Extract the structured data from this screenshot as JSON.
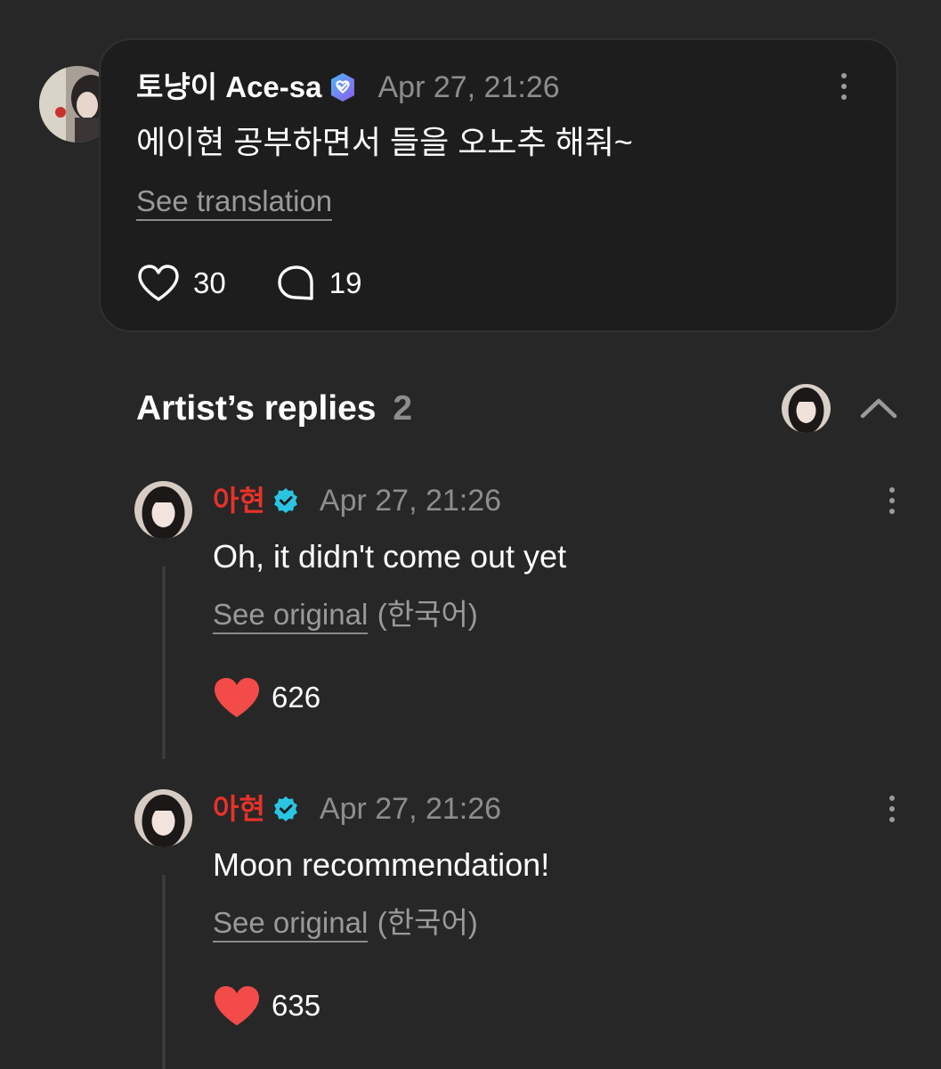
{
  "post": {
    "author": "토냥이 Ace-sa",
    "timestamp": "Apr 27, 21:26",
    "text": "에이현 공부하면서 들을 오노추 해줘~",
    "translation_link": "See translation",
    "likes": "30",
    "comments": "19",
    "badge_color": "#7b6cf0"
  },
  "replies_section": {
    "title": "Artist’s replies",
    "count": "2"
  },
  "replies": [
    {
      "author": "아현",
      "timestamp": "Apr 27, 21:26",
      "text": "Oh, it didn't come out yet",
      "original_link": "See original",
      "original_lang": "(한국어)",
      "likes": "626"
    },
    {
      "author": "아현",
      "timestamp": "Apr 27, 21:26",
      "text": "Moon recommendation!",
      "original_link": "See original",
      "original_lang": "(한국어)",
      "likes": "635"
    }
  ],
  "colors": {
    "background": "#272727",
    "card": "#1d1d1d",
    "artist_name": "#e8322a",
    "heart_filled": "#f24b48",
    "verified_artist": "#29c5e3"
  },
  "icons": [
    "user-avatar",
    "verified-badge-icon",
    "more-options-icon",
    "heart-outline-icon",
    "comment-icon",
    "artist-avatar",
    "collapse-chevron-icon",
    "heart-filled-icon"
  ]
}
